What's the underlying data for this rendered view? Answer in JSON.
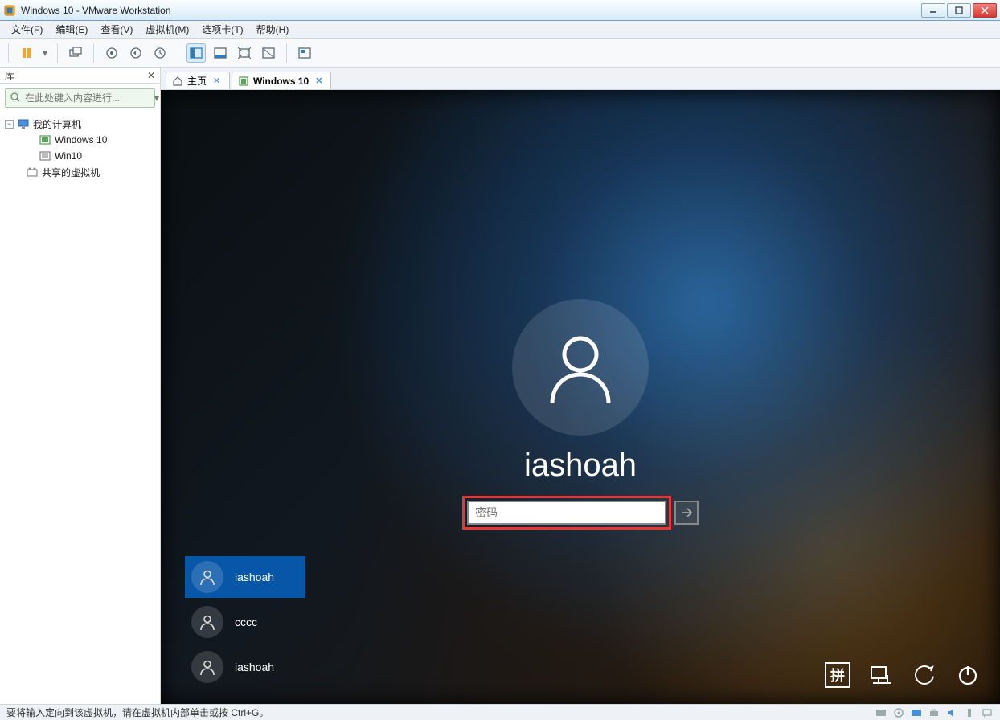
{
  "window": {
    "title": "Windows 10 - VMware Workstation"
  },
  "menu": {
    "file": "文件(F)",
    "edit": "编辑(E)",
    "view": "查看(V)",
    "vm": "虚拟机(M)",
    "tabs": "选项卡(T)",
    "help": "帮助(H)"
  },
  "library": {
    "title": "库",
    "search_placeholder": "在此处键入内容进行...",
    "my_computer": "我的计算机",
    "vm1": "Windows 10",
    "vm2": "Win10",
    "shared": "共享的虚拟机"
  },
  "tabs": {
    "home": "主页",
    "vm": "Windows 10"
  },
  "lock": {
    "username": "iashoah",
    "password_placeholder": "密码",
    "users": [
      {
        "name": "iashoah",
        "selected": true
      },
      {
        "name": "cccc",
        "selected": false
      },
      {
        "name": "iashoah",
        "selected": false
      }
    ],
    "ime": "拼"
  },
  "status": {
    "message": "要将输入定向到该虚拟机，请在虚拟机内部单击或按 Ctrl+G。"
  }
}
